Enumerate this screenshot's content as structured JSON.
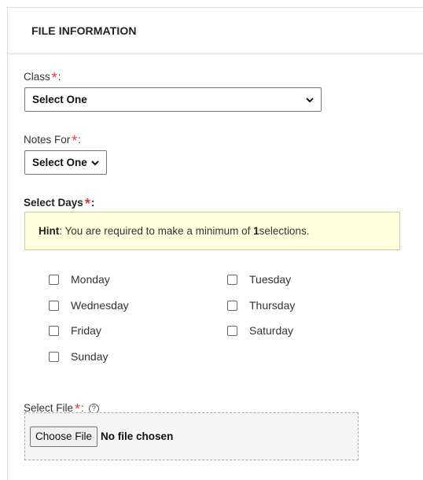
{
  "section": {
    "title": "FILE INFORMATION"
  },
  "class_field": {
    "label": "Class",
    "required_mark": "*",
    "suffix": ":",
    "selected": "Select One"
  },
  "notes_field": {
    "label": "Notes For",
    "required_mark": "*",
    "suffix": ":",
    "selected": "Select One"
  },
  "days_field": {
    "label": "Select Days",
    "required_mark": "*",
    "suffix": ":",
    "hint_prefix": "Hint",
    "hint_text_1": ": You are required to make a minimum of ",
    "hint_count": "1",
    "hint_text_2": " selections.",
    "days": [
      {
        "label": "Monday",
        "checked": false
      },
      {
        "label": "Tuesday",
        "checked": false
      },
      {
        "label": "Wednesday",
        "checked": false
      },
      {
        "label": "Thursday",
        "checked": false
      },
      {
        "label": "Friday",
        "checked": false
      },
      {
        "label": "Saturday",
        "checked": false
      },
      {
        "label": "Sunday",
        "checked": false
      }
    ]
  },
  "file_field": {
    "label": "Select File",
    "required_mark": "*",
    "suffix": ":",
    "help_icon": "?",
    "button_label": "Choose File",
    "status": "No file chosen"
  },
  "colors": {
    "required": "#e53935",
    "hint_bg": "#ffffde",
    "border": "#dcdcdc"
  }
}
